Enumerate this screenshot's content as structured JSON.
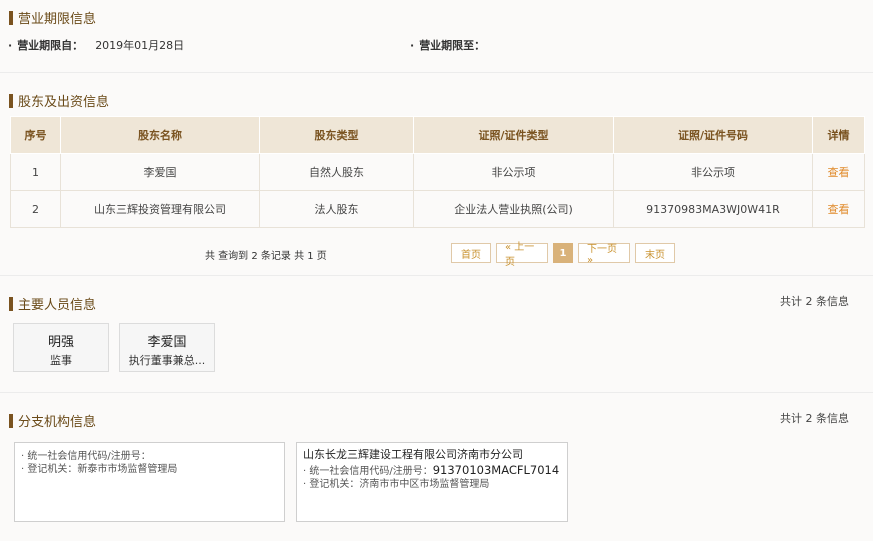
{
  "business_term": {
    "title": "营业期限信息",
    "from_label": "营业期限自：",
    "from_value": "2019年01月28日",
    "to_label": "营业期限至：",
    "to_value": ""
  },
  "shareholders": {
    "title": "股东及出资信息",
    "headers": [
      "序号",
      "股东名称",
      "股东类型",
      "证照/证件类型",
      "证照/证件号码",
      "详情"
    ],
    "rows": [
      {
        "no": "1",
        "name": "李爱国",
        "type": "自然人股东",
        "cert_type": "非公示项",
        "cert_no": "非公示项",
        "detail": "查看"
      },
      {
        "no": "2",
        "name": "山东三辉投资管理有限公司",
        "type": "法人股东",
        "cert_type": "企业法人营业执照(公司)",
        "cert_no": "91370983MA3WJ0W41R",
        "detail": "查看"
      }
    ],
    "pager_info": "共 查询到 2 条记录 共 1 页",
    "pager": {
      "first": "首页",
      "prev": "« 上一页",
      "current": "1",
      "next": "下一页 »",
      "last": "末页"
    }
  },
  "personnel": {
    "title": "主要人员信息",
    "count": "共计 2 条信息",
    "people": [
      {
        "name": "明强",
        "role": "监事"
      },
      {
        "name": "李爱国",
        "role": "执行董事兼总..."
      }
    ]
  },
  "branches": {
    "title": "分支机构信息",
    "count": "共计 2 条信息",
    "items": [
      {
        "name": "",
        "code_label": "· 统一社会信用代码/注册号：",
        "code": "",
        "authority_label": "· 登记机关：",
        "authority": "新泰市市场监督管理局"
      },
      {
        "name": "山东长龙三辉建设工程有限公司济南市分公司",
        "code_label": "· 统一社会信用代码/注册号：",
        "code": "91370103MACFL7014",
        "authority_label": "· 登记机关：",
        "authority": "济南市市中区市场监督管理局"
      }
    ]
  }
}
